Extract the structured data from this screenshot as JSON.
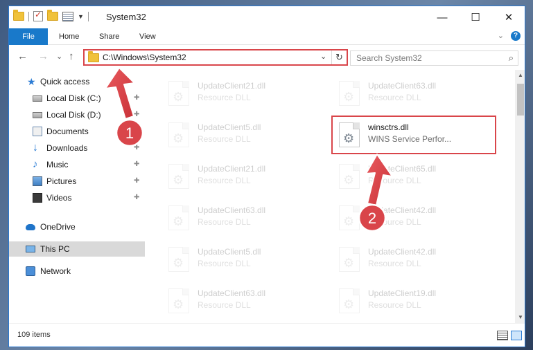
{
  "window": {
    "title": "System32",
    "controls": {
      "minimize": "—",
      "maximize": "☐",
      "close": "✕"
    }
  },
  "ribbon": {
    "tabs": [
      "File",
      "Home",
      "Share",
      "View"
    ],
    "expand_glyph": "⌄"
  },
  "nav": {
    "back": "←",
    "forward": "→",
    "recent": "⌄",
    "up": "↑",
    "address": "C:\\Windows\\System32",
    "address_dropdown": "⌄",
    "refresh": "↻",
    "search_placeholder": "Search System32",
    "search_glyph": "⌕"
  },
  "sidebar": {
    "items": [
      {
        "label": "Quick access",
        "icon": "quick-access-star-icon",
        "pinned": false
      },
      {
        "label": "Local Disk (C:)",
        "icon": "local-disk-icon",
        "pinned": true
      },
      {
        "label": "Local Disk (D:)",
        "icon": "local-disk-icon",
        "pinned": true
      },
      {
        "label": "Documents",
        "icon": "documents-icon",
        "pinned": true
      },
      {
        "label": "Downloads",
        "icon": "downloads-icon",
        "pinned": true
      },
      {
        "label": "Music",
        "icon": "music-icon",
        "pinned": true
      },
      {
        "label": "Pictures",
        "icon": "pictures-icon",
        "pinned": true
      },
      {
        "label": "Videos",
        "icon": "videos-icon",
        "pinned": true
      },
      {
        "label": "OneDrive",
        "icon": "onedrive-cloud-icon",
        "pinned": false
      },
      {
        "label": "This PC",
        "icon": "this-pc-icon",
        "pinned": false,
        "selected": true
      },
      {
        "label": "Network",
        "icon": "network-icon",
        "pinned": false
      }
    ],
    "pin_glyph": "📌"
  },
  "files": {
    "left": [
      {
        "name": "UpdateClient21.dll",
        "type": "Resource DLL"
      },
      {
        "name": "UpdateClient5.dll",
        "type": "Resource DLL"
      },
      {
        "name": "UpdateClient21.dll",
        "type": "Resource DLL"
      },
      {
        "name": "UpdateClient63.dll",
        "type": "Resource DLL"
      },
      {
        "name": "UpdateClient5.dll",
        "type": "Resource DLL"
      },
      {
        "name": "UpdateClient63.dll",
        "type": "Resource DLL"
      }
    ],
    "right": [
      {
        "name": "UpdateClient63.dll",
        "type": "Resource DLL"
      },
      {
        "name": "winsctrs.dll",
        "type": "WINS Service Perfor...",
        "highlight": true
      },
      {
        "name": "UpdateClient65.dll",
        "type": "Resource DLL"
      },
      {
        "name": "UpdateClient42.dll",
        "type": "Resource DLL"
      },
      {
        "name": "UpdateClient42.dll",
        "type": "Resource DLL"
      },
      {
        "name": "UpdateClient19.dll",
        "type": "Resource DLL"
      }
    ]
  },
  "status": {
    "count": "109 items"
  },
  "annotations": {
    "step1": "1",
    "step2": "2",
    "colors": {
      "red": "#d9454a",
      "accent": "#1979ca"
    }
  }
}
